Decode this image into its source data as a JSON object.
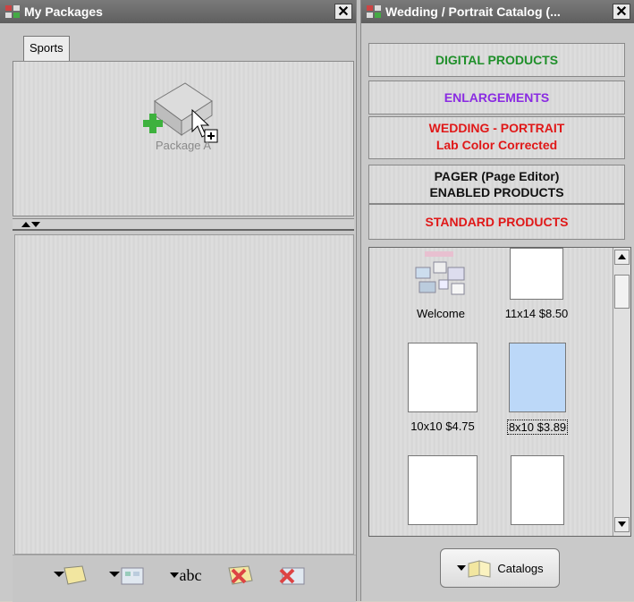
{
  "left_panel": {
    "title": "My Packages",
    "tab_label": "Sports",
    "package_label": "Package A"
  },
  "right_panel": {
    "title": "Wedding / Portrait Catalog (...",
    "categories": [
      {
        "line1": "DIGITAL PRODUCTS",
        "line2": "",
        "color": "#1f8f2a"
      },
      {
        "line1": "ENLARGEMENTS",
        "line2": "",
        "color": "#8a2be2"
      },
      {
        "line1": "WEDDING - PORTRAIT",
        "line2": "Lab Color Corrected",
        "color": "#e01818"
      },
      {
        "line1": "PAGER (Page Editor)",
        "line2": "ENABLED PRODUCTS",
        "color": "#111111"
      },
      {
        "line1": "STANDARD PRODUCTS",
        "line2": "",
        "color": "#e01818"
      }
    ],
    "items": [
      {
        "label": "Welcome"
      },
      {
        "label": "11x14 $8.50"
      },
      {
        "label": "10x10 $4.75"
      },
      {
        "label": "8x10 $3.89"
      },
      {
        "label": ""
      },
      {
        "label": ""
      }
    ],
    "catalogs_button": "Catalogs"
  },
  "toolbar": {
    "text_tool": "abc"
  }
}
